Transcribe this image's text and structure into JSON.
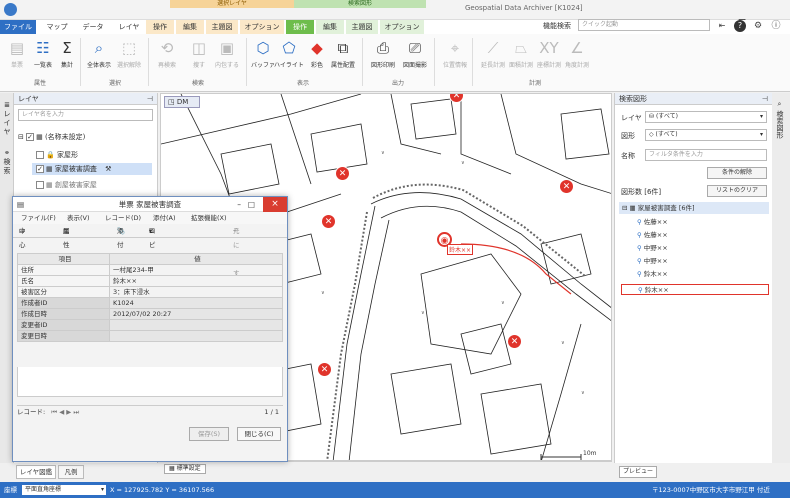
{
  "window": {
    "title": "Geospatial Data Archiver [K1024]",
    "context_groups": [
      "選択レイヤ",
      "検索図形"
    ],
    "quick_search_label": "機能検索",
    "quick_search_placeholder": "クイック起動"
  },
  "tabs": [
    {
      "label": "ファイル",
      "active": true
    },
    {
      "label": "マップ"
    },
    {
      "label": "データ"
    },
    {
      "label": "レイヤ"
    },
    {
      "label": "操作"
    },
    {
      "label": "編集"
    },
    {
      "label": "主題図"
    },
    {
      "label": "オプション"
    },
    {
      "label": "操作"
    },
    {
      "label": "編集"
    },
    {
      "label": "主題図"
    },
    {
      "label": "オプション"
    }
  ],
  "ribbon": {
    "buttons": [
      "単票",
      "一覧表",
      "集計",
      "全体表示",
      "選択解除",
      "再検索",
      "捜す",
      "内包する",
      "バッファ",
      "ハイライト",
      "彩色",
      "属性配置",
      "図形印刷",
      "図面撮影",
      "位置情報",
      "延長計測",
      "面積計測",
      "座標計測",
      "角度計測"
    ],
    "groups": [
      "属性",
      "選択",
      "検索",
      "表示",
      "出力",
      "計測"
    ]
  },
  "side_tabs": [
    "レイヤ",
    "検索"
  ],
  "layer_panel": {
    "title": "レイヤ",
    "search_placeholder": "レイヤ名を入力",
    "items": [
      "(名称未設定)",
      "家屋形",
      "家屋被害調査",
      "創屋被害家屋"
    ]
  },
  "map": {
    "tab": "DM",
    "scale": "10m",
    "status": "標準設定",
    "selected_label": "鈴木××"
  },
  "search_panel": {
    "title": "検索図形",
    "layer_label": "レイヤ",
    "layer_value": "(すべて)",
    "shape_label": "図形",
    "shape_value": "(すべて)",
    "name_label": "名称",
    "name_placeholder": "フィルタ条件を入力",
    "release_button": "条件の解除",
    "count_label": "図形数 [6件]",
    "clear_button": "リストのクリア",
    "group": "家屋被害調査 [6件]",
    "results": [
      "佐藤××",
      "佐藤××",
      "中野××",
      "中野××",
      "鈴木××",
      "鈴木××"
    ],
    "preview_button": "プレビュー",
    "right_tab": "検索図形"
  },
  "bottom_tabs": [
    "レイヤ図鑑",
    "凡例"
  ],
  "status_bar": {
    "label": "座標",
    "crs": "平面直角座標",
    "coords": "X = 127925.782 Y = 36107.566",
    "address": "〒123-0007中野区市大字市野江甲 付近"
  },
  "dialog": {
    "title": "単票 家屋被害調査",
    "menu": [
      "ファイル(F)",
      "表示(V)",
      "レコード(D)",
      "添付(A)",
      "拡張機能(X)"
    ],
    "toolbar": [
      "中心移動",
      "属性ツリー",
      "添付",
      "コピー",
      "元に戻す"
    ],
    "header_item": "項目",
    "header_value": "値",
    "rows": [
      {
        "k": "住所",
        "v": "一村尾234-甲"
      },
      {
        "k": "氏名",
        "v": "鈴木××"
      },
      {
        "k": "被害区分",
        "v": "3：床下浸水"
      },
      {
        "k": "作成者ID",
        "v": "K1024"
      },
      {
        "k": "作成日時",
        "v": "2012/07/02 20:27"
      },
      {
        "k": "変更者ID",
        "v": ""
      },
      {
        "k": "変更日時",
        "v": ""
      }
    ],
    "record_label": "レコード:",
    "record_nav": "⏮ ◀ ▶ ⏭",
    "record_count": "1 / 1",
    "save_button": "保存(S)",
    "close_button": "閉じる(C)"
  }
}
